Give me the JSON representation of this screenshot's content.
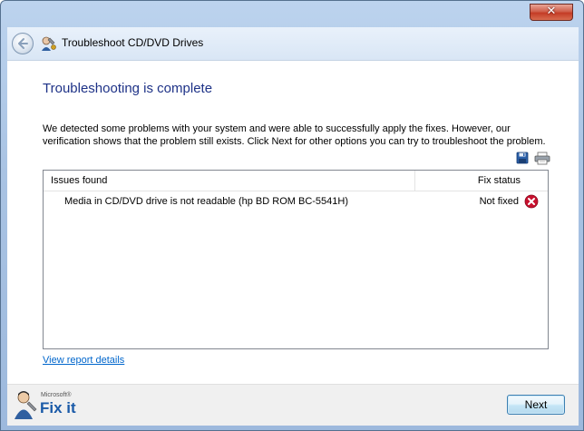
{
  "window": {
    "close_label": "✕"
  },
  "header": {
    "title": "Troubleshoot CD/DVD Drives",
    "back_icon": "back-arrow-icon",
    "title_icon": "troubleshooter-icon"
  },
  "main": {
    "heading": "Troubleshooting is complete",
    "description": "We detected some problems with your system and were able to successfully apply the fixes. However, our verification shows that the problem still exists. Click Next for other options you can try to troubleshoot the problem.",
    "toolbar_icons": [
      "save-icon",
      "print-icon"
    ],
    "table": {
      "columns": [
        "Issues found",
        "Fix status"
      ],
      "rows": [
        {
          "issue": "Media in CD/DVD drive is not readable (hp BD ROM BC-5541H)",
          "status": "Not fixed",
          "status_icon": "error-icon"
        }
      ]
    },
    "report_link": "View report details"
  },
  "footer": {
    "brand_small": "Microsoft®",
    "brand_main": "Fix it",
    "next_label": "Next"
  },
  "colors": {
    "heading": "#1e3287",
    "link": "#0066cc",
    "error": "#c8102e",
    "close_button": "#c43c26"
  }
}
